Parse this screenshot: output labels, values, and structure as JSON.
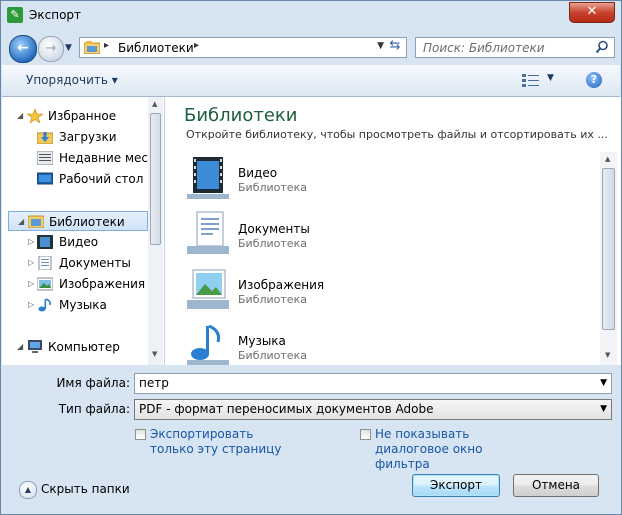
{
  "window": {
    "title": "Экспорт",
    "close_glyph": "✕"
  },
  "nav": {
    "address": "Библиотеки",
    "search_placeholder": "Поиск: Библиотеки"
  },
  "toolbar": {
    "organize_label": "Упорядочить ▾",
    "help_glyph": "?"
  },
  "navpane": {
    "items": [
      {
        "label": "Избранное",
        "icon": "star-icon"
      },
      {
        "label": "Загрузки",
        "icon": "downloads-folder-icon"
      },
      {
        "label": "Недавние места",
        "icon": "recent-places-icon"
      },
      {
        "label": "Рабочий стол",
        "icon": "desktop-icon"
      },
      {
        "label": "Библиотеки",
        "icon": "libraries-icon"
      },
      {
        "label": "Видео",
        "icon": "video-library-icon"
      },
      {
        "label": "Документы",
        "icon": "documents-library-icon"
      },
      {
        "label": "Изображения",
        "icon": "pictures-library-icon"
      },
      {
        "label": "Музыка",
        "icon": "music-library-icon"
      },
      {
        "label": "Компьютер",
        "icon": "computer-icon"
      }
    ]
  },
  "main": {
    "title": "Библиотеки",
    "description": "Откройте библиотеку, чтобы просмотреть файлы и отсортировать их ...",
    "libraries": [
      {
        "name": "Видео",
        "type": "Библиотека",
        "icon": "video-library-icon"
      },
      {
        "name": "Документы",
        "type": "Библиотека",
        "icon": "documents-library-icon"
      },
      {
        "name": "Изображения",
        "type": "Библиотека",
        "icon": "pictures-library-icon"
      },
      {
        "name": "Музыка",
        "type": "Библиотека",
        "icon": "music-library-icon"
      }
    ]
  },
  "form": {
    "filename_label": "Имя файла:",
    "filename_value": "петр",
    "filetype_label": "Тип файла:",
    "filetype_value": "PDF - формат переносимых документов Adobe",
    "export_page_only_line1": "Экспортировать",
    "export_page_only_line2": "только эту страницу",
    "no_filter_dialog_line1": "Не показывать",
    "no_filter_dialog_line2": "диалоговое окно",
    "no_filter_dialog_line3": "фильтра",
    "hide_folders_label": "Скрыть папки",
    "export_button": "Экспорт",
    "cancel_button": "Отмена"
  },
  "colors": {
    "accent_title": "#1e5f3d",
    "link_blue": "#1a55a5",
    "frame": "#d7e4f2"
  }
}
